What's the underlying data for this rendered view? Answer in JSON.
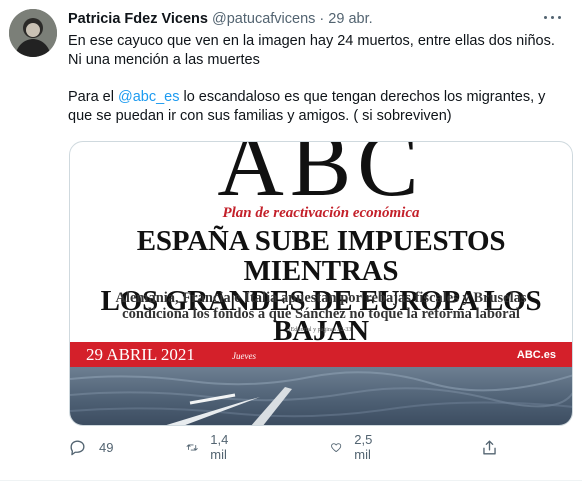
{
  "tweet": {
    "author_name": "Patricia Fdez Vicens",
    "handle": "@patucafvicens",
    "separator": "·",
    "date": "29 abr.",
    "line1": "En ese cayuco que ven en la imagen hay 24 muertos, entre ellas dos niños.",
    "line2": "Ni una mención a las muertes",
    "line3_prefix": "Para el ",
    "line3_mention": "@abc_es",
    "line3_suffix": " lo escandaloso es que tengan derechos los migrantes, y",
    "line4": "que se puedan ir con sus familias y amigos. ( si sobreviven)"
  },
  "media": {
    "masthead": "ABC",
    "plan": "Plan de reactivación económica",
    "headline_1": "ESPAÑA SUBE IMPUESTOS MIENTRAS",
    "headline_2": "LOS GRANDES DE EUROPA LOS BAJAN",
    "sub_1": "Alemania, Francia e Italia apuestan por rebajas fiscales y Bruselas",
    "sub_2": "condiciona los fondos a que Sánchez no toque la reforma laboral",
    "small": "[Editorial y páginas 32-33]",
    "band_date": "29 ABRIL 2021",
    "band_day": "Jueves",
    "band_site": "ABC.es"
  },
  "actions": {
    "reply_count": "49",
    "retweet_count": "1,4 mil",
    "like_count": "2,5 mil"
  },
  "colors": {
    "link": "#1d9bf0",
    "muted": "#536471",
    "abc_red": "#d4202a"
  }
}
